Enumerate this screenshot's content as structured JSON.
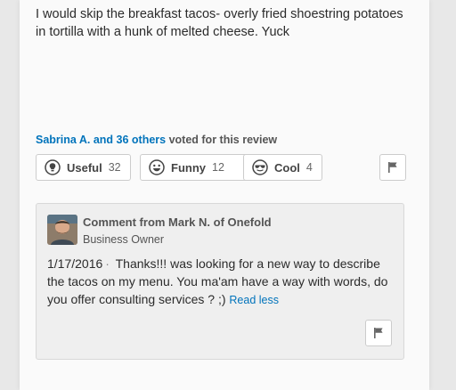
{
  "review": {
    "text": "I would skip the breakfast tacos- overly fried shoestring potatoes in tortilla with a hunk of melted cheese. Yuck"
  },
  "votes": {
    "voters": "Sabrina A. and 36 others",
    "suffix": " voted for this review",
    "useful": {
      "label": "Useful",
      "count": "32",
      "icon": "lightbulb-icon"
    },
    "funny": {
      "label": "Funny",
      "count": "12",
      "icon": "smiley-icon"
    },
    "cool": {
      "label": "Cool",
      "count": "4",
      "icon": "sunglasses-icon"
    }
  },
  "comment": {
    "title": "Comment from Mark N. of Onefold",
    "role": "Business Owner",
    "date": "1/17/2016",
    "separator": "·",
    "text": "Thanks!!! was looking for a new way to describe the tacos on my menu. You ma'am have a way with words, do you offer consulting services ? ;)",
    "read_less": "Read less"
  },
  "colors": {
    "link": "#0073bb",
    "card_bg": "#fafafa",
    "comment_bg": "#efefef"
  }
}
